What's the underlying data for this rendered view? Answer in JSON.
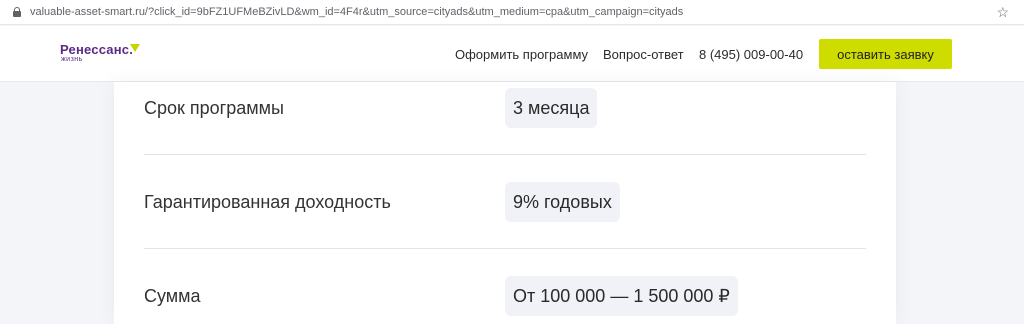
{
  "browser": {
    "url": "valuable-asset-smart.ru/?click_id=9bFZ1UFMeBZivLD&wm_id=4F4r&utm_source=cityads&utm_medium=cpa&utm_campaign=cityads",
    "star_icon": "star-icon",
    "lock_icon": "lock-icon"
  },
  "header": {
    "logo_main": "Ренессанс.",
    "logo_sub": "жизнь",
    "nav": [
      "Оформить программу",
      "Вопрос-ответ"
    ],
    "phone": "8 (495) 009-00-40",
    "cta_label": "оставить заявку",
    "accent_color": "#cfdc00",
    "brand_color": "#5b2a86"
  },
  "details": [
    {
      "label": "Срок программы",
      "value": "3 месяца"
    },
    {
      "label": "Гарантированная доходность",
      "value": "9% годовых"
    },
    {
      "label": "Сумма",
      "value": "От 100 000 — 1 500 000 ₽"
    }
  ]
}
